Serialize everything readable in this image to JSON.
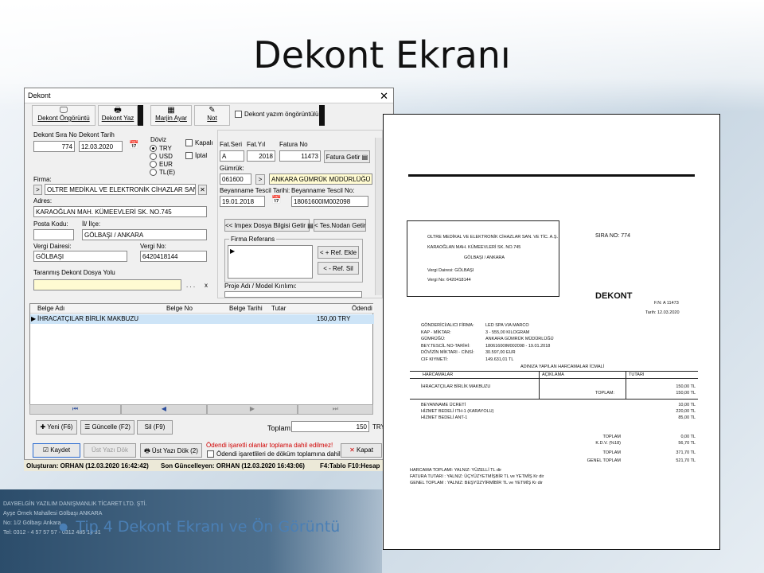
{
  "slide": {
    "title": "Dekont Ekranı",
    "bullet": "Tip 4 Dekont Ekranı ve Ön Görüntü",
    "bg_lines": [
      "DAYBELGİN YAZILIM DANIŞMANLIK TİCARET LTD. ŞTİ.",
      "Ayşe Örnek Mahallesi Gölbaşı ANKARA",
      "No: 1/2 Gölbaşı Ankara",
      "Tel: 0312 - 4 57 57 57 - 0312 485 14 31"
    ]
  },
  "window": {
    "title": "Dekont",
    "toolbar": {
      "preview": "Dekont Öngörüntü",
      "print": "Dekont Yaz",
      "margin": "Marjin Ayar",
      "note": "Not",
      "print_preview_check": "Dekont yazım öngörüntülü"
    },
    "form": {
      "sira_no_label": "Dekont Sıra No",
      "sira_no": "774",
      "tarih_label": "Dekont Tarih",
      "tarih": "12.03.2020",
      "doviz_label": "Döviz",
      "currencies": [
        "TRY",
        "USD",
        "EUR",
        "TL(E)"
      ],
      "kapali": "Kapalı",
      "iptal": "İptal",
      "firma_label": "Firma:",
      "firma": "OLTRE MEDİKAL VE ELEKTRONİK CİHAZLAR SAN.",
      "adres_label": "Adres:",
      "adres": "KARAOĞLAN MAH. KÜMEEVLERİ SK. NO.745",
      "posta_label": "Posta Kodu:",
      "posta": "",
      "il_label": "İl/ İlçe:",
      "il": "GÖLBAŞI / ANKARA",
      "vd_label": "Vergi Dairesi:",
      "vd": "GÖLBAŞI",
      "vno_label": "Vergi No:",
      "vno": "6420418144",
      "taranmis_label": "Taranmış Dekont Dosya Yolu",
      "taranmis": "",
      "fat_seri_label": "Fat.Seri",
      "fat_seri": "A",
      "fat_yil_label": "Fat.Yıl",
      "fat_yil": "2018",
      "fat_no_label": "Fatura No",
      "fat_no": "11473",
      "fatura_getir": "Fatura Getir",
      "gumruk_label": "Gümrük:",
      "gumruk_kod": "061600",
      "gumruk_ad": "ANKARA GÜMRÜK MÜDÜRLÜĞÜ",
      "beyan_tarih_label": "Beyanname Tescil Tarihi:",
      "beyan_tarih": "19.01.2018",
      "beyan_no_label": "Beyanname Tescil No:",
      "beyan_no": "18061600IM002098",
      "impex_btn": "<< Impex Dosya Bilgisi Getir",
      "tes_btn": "< Tes.Nodan Getir",
      "firma_ref_label": "Firma Referans",
      "ref_ekle": "< + Ref. Ekle",
      "ref_sil": "< - Ref. Sil",
      "proje_label": "Proje Adı / Model Kırılımı:"
    },
    "grid": {
      "headers": [
        "Belge Adı",
        "Belge No",
        "Belge Tarihi",
        "Tutar",
        "Ödendi"
      ],
      "rows": [
        {
          "belge_adi": "İHRACATÇILAR BİRLİK MAKBUZU",
          "belge_no": "",
          "belge_tarihi": "",
          "tutar": "150,00 TRY",
          "odendi": ""
        }
      ]
    },
    "buttons": {
      "yeni": "Yeni (F6)",
      "guncelle": "Güncelle (F2)",
      "sil": "Sil (F9)",
      "toplam_label": "Toplam:",
      "toplam": "150",
      "toplam_cur": "TRY",
      "kaydet": "Kaydet",
      "ust_yazi_dok": "Üst Yazı Dök",
      "ust_yazi_dok2": "Üst Yazı Dök (2)",
      "warning": "Ödendi işaretli olanlar toplama dahil edilmez!",
      "odendi_check": "Ödendi işaretlileri de döküm toplamına dahil et",
      "kapat": "Kapat"
    },
    "status": {
      "created": "Oluşturan: ORHAN (12.03.2020 16:42:42)",
      "updated": "Son Güncelleyen: ORHAN (12.03.2020 16:43:06)",
      "keys": "F4:Tablo F10:Hesap"
    }
  },
  "document": {
    "company": "OLTRE MEDİKAL VE ELEKTRONİK CİHAZLAR SAN. VE TİC. A.Ş.",
    "address": "KARAOĞLAN MAH. KÜMEEVLERİ SK. NO.745",
    "city": "GÖLBAŞI / ANKARA",
    "sira_no": "SIRA NO: 774",
    "vd": "Vergi Dairesi:   GÖLBAŞI",
    "vno": "Vergi No:      6420418144",
    "heading": "DEKONT",
    "fn": "F.N:  A 11473",
    "tarih": "Tarih:  12.03.2020",
    "info": [
      [
        "GÖNDERİCİ/ALICI FİRMA:",
        "LED SPA VIA MARCO"
      ],
      [
        "KAP - MİKTAR:",
        "3 - 555,00 KILOGRAM"
      ],
      [
        "GÜMRÜĞÜ:",
        "ANKARA GÜMRÜK MÜDÜRLÜĞÜ"
      ],
      [
        "BEY.TESCİL NO-TARİHİ:",
        "18061600IM002098 - 19.01.2018"
      ],
      [
        "DÖVİZİN MİKTARI - CİNSİ:",
        "30.597,00 EUR"
      ],
      [
        "CIF KIYMETİ:",
        "149.631,01 TL"
      ]
    ],
    "table_title": "ADINIZA YAPILAN HARCAMALAR İCMALİ",
    "cols": [
      "HARCAMALAR",
      "AÇIKLAMA",
      "TUTARI"
    ],
    "rows1": [
      [
        "İHRACATÇILAR BİRLİK MAKBUZU",
        "150,00 TL"
      ]
    ],
    "toplam1": [
      "TOPLAM:",
      "150,00 TL"
    ],
    "rows2": [
      [
        "BEYANNAME ÜCRETİ",
        "10,00 TL"
      ],
      [
        "HİZMET BEDELİ ITH-1 (KARAYOLU)",
        "220,00 TL"
      ],
      [
        "HİZMET BEDELİ ANT-1",
        "85,00 TL"
      ]
    ],
    "totals": [
      [
        "TOPLAM",
        "0,00 TL"
      ],
      [
        "K.D.V. (%18)",
        "56,70 TL"
      ],
      [
        "TOPLAM",
        "371,70 TL"
      ],
      [
        "GENEL TOPLAM",
        "521,70 TL"
      ]
    ],
    "footer": [
      "HARCAMA TOPLAMI: YALNIZ: YÜZELLİ  TL  dir",
      "FATURA TUTARI : YALNIZ: ÜÇYÜZYETMİŞBİR  TL  ve YETMİŞ  Kr dir",
      "GENEL TOPLAM : YALNIZ: BEŞYÜZYİRMİBİR  TL  ve YETMİŞ  Kr dir"
    ]
  }
}
